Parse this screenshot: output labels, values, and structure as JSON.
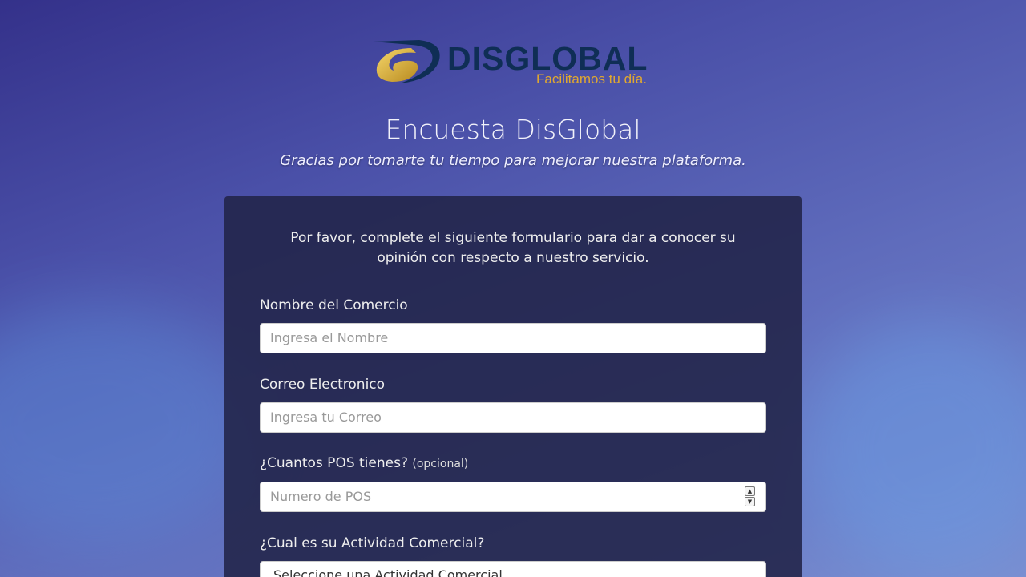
{
  "brand": {
    "name": "DISGLOBAL",
    "tagline": "Facilitamos tu día.",
    "colors": {
      "navy": "#0f2e55",
      "gold": "#e0b040"
    }
  },
  "header": {
    "title": "Encuesta DisGlobal",
    "subtitle": "Gracias por tomarte tu tiempo para mejorar nuestra plataforma."
  },
  "form": {
    "intro": "Por favor, complete el siguiente formulario para dar a conocer su opinión con respecto a nuestro servicio.",
    "fields": [
      {
        "label": "Nombre del Comercio",
        "placeholder": "Ingresa el Nombre"
      },
      {
        "label": "Correo Electronico",
        "placeholder": "Ingresa tu Correo"
      },
      {
        "label": "¿Cuantos POS tienes?",
        "note": "(opcional)",
        "placeholder": "Numero de POS"
      },
      {
        "label": "¿Cual es su Actividad Comercial?",
        "selected": "Seleccione una Actividad Comercial"
      }
    ]
  }
}
